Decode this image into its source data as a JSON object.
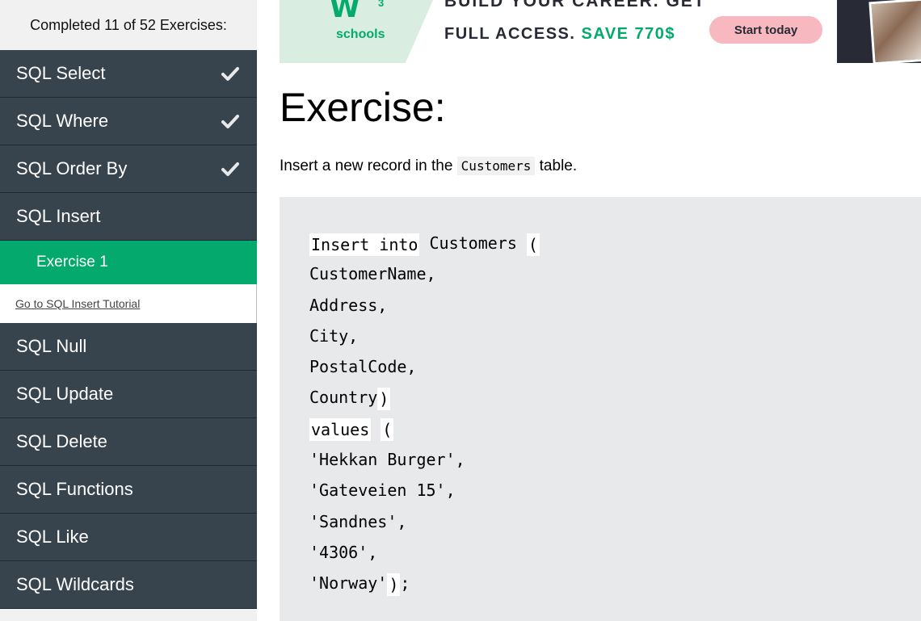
{
  "sidebar": {
    "progress_text": "Completed 11 of 52 Exercises:",
    "items": [
      {
        "label": "SQL Select",
        "completed": true
      },
      {
        "label": "SQL Where",
        "completed": true
      },
      {
        "label": "SQL Order By",
        "completed": true
      },
      {
        "label": "SQL Insert",
        "completed": false
      }
    ],
    "active_sub_item": "Exercise 1",
    "tutorial_link": "Go to SQL Insert Tutorial",
    "items_after": [
      {
        "label": "SQL Null"
      },
      {
        "label": "SQL Update"
      },
      {
        "label": "SQL Delete"
      },
      {
        "label": "SQL Functions"
      },
      {
        "label": "SQL Like"
      },
      {
        "label": "SQL Wildcards"
      }
    ]
  },
  "ad": {
    "logo_text": "schools",
    "logo_superscript": "3",
    "headline_line1": "BUILD YOUR CAREER. GET",
    "headline_line2": "FULL ACCESS.",
    "headline_save": "SAVE 770$",
    "cta_label": "Start today",
    "colors": {
      "brand_green": "#04aa6d",
      "cta_pink": "#f7b8c0",
      "dark": "#282a35"
    }
  },
  "exercise": {
    "title": "Exercise:",
    "instruction_before": "Insert a new record in the ",
    "instruction_code": "Customers",
    "instruction_after": " table.",
    "code": {
      "blank1": "Insert into",
      "line1_after": " Customers ",
      "blank2": "(",
      "line2": "CustomerName,",
      "line3": "Address,",
      "line4": "City,",
      "line5": "PostalCode,",
      "line6_before": "Country",
      "blank3": ")",
      "blank4": "values",
      "line7_mid": " ",
      "blank5": "(",
      "line8": "'Hekkan Burger',",
      "line9": "'Gateveien 15',",
      "line10": "'Sandnes',",
      "line11": "'4306',",
      "line12_before": "'Norway'",
      "blank6": ")",
      "line12_after": ";"
    }
  },
  "colors": {
    "sidebar_bg": "#38444d",
    "active_green": "#04aa6d",
    "code_bg": "#e7e9eb"
  }
}
